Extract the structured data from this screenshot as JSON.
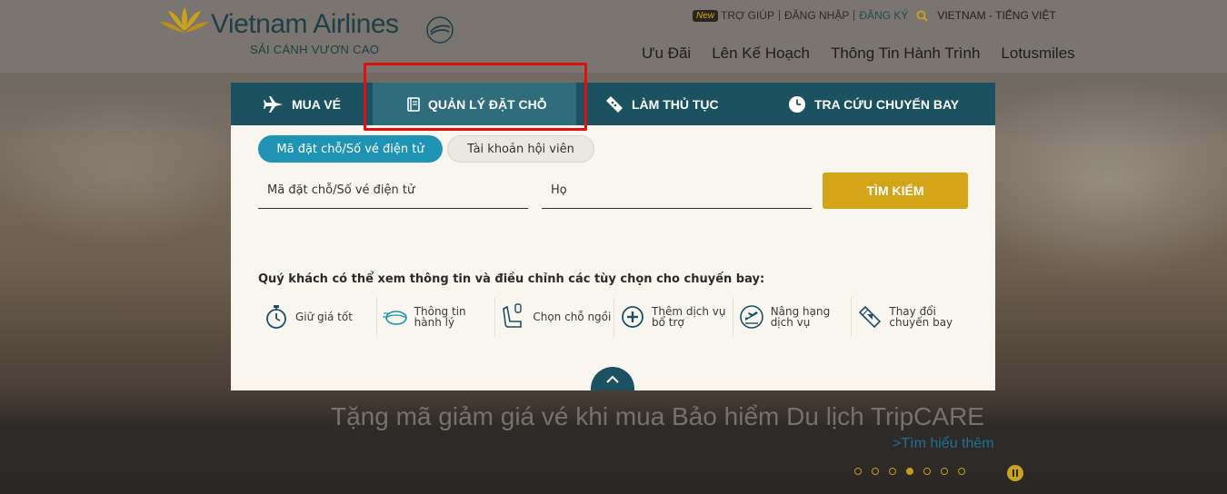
{
  "header": {
    "logo_text": "Vietnam Airlines",
    "tagline": "SẢI CÁNH VƯƠN CAO",
    "util": {
      "new_badge": "New",
      "help": "TRỢ GIÚP",
      "login": "ĐĂNG NHẬP",
      "register": "ĐĂNG KÝ",
      "language": "VIETNAM - TIẾNG VIỆT"
    },
    "nav": [
      "Ưu Đãi",
      "Lên Kế Hoạch",
      "Thông Tin Hành Trình",
      "Lotusmiles"
    ]
  },
  "widget": {
    "tabs": [
      {
        "label": "MUA VÉ",
        "icon": "plane-icon"
      },
      {
        "label": "QUẢN LÝ ĐẶT CHỖ",
        "icon": "booklet-icon"
      },
      {
        "label": "LÀM THỦ TỤC",
        "icon": "ticket-icon"
      },
      {
        "label": "TRA CỨU CHUYẾN BAY",
        "icon": "clock-icon"
      }
    ],
    "active_tab": "QUẢN LÝ ĐẶT CHỖ",
    "subtabs": [
      "Mã đặt chỗ/Số vé điện tử",
      "Tài khoản hội viên"
    ],
    "fields": {
      "code_placeholder": "Mã đặt chỗ/Số vé điện tử",
      "name_placeholder": "Họ"
    },
    "search_button": "TÌM KIẾM",
    "info_heading": "Quý khách có thể xem thông tin và điều chỉnh các tùy chọn cho chuyến bay:",
    "options": [
      {
        "label": "Giữ giá tốt",
        "icon": "stopwatch-icon"
      },
      {
        "label": "Thông tin hành lý",
        "icon": "baggage-icon"
      },
      {
        "label": "Chọn chỗ ngồi",
        "icon": "seat-icon"
      },
      {
        "label": "Thêm dịch vụ bổ trợ",
        "icon": "plus-circle-icon"
      },
      {
        "label": "Nâng hạng dịch vụ",
        "icon": "upgrade-icon"
      },
      {
        "label": "Thay đổi chuyến bay",
        "icon": "change-ticket-icon"
      }
    ]
  },
  "banner": {
    "title": "Tặng mã giảm giá vé khi mua Bảo hiểm Du lịch TripCARE",
    "link": ">Tìm hiểu thêm",
    "slides": 7,
    "active_slide": 4
  },
  "colors": {
    "tab_bar": "#1b5161",
    "active_tab": "#2f6c7c",
    "pill_active": "#1e93b3",
    "search_button": "#d4a418",
    "highlight": "#e01010"
  }
}
